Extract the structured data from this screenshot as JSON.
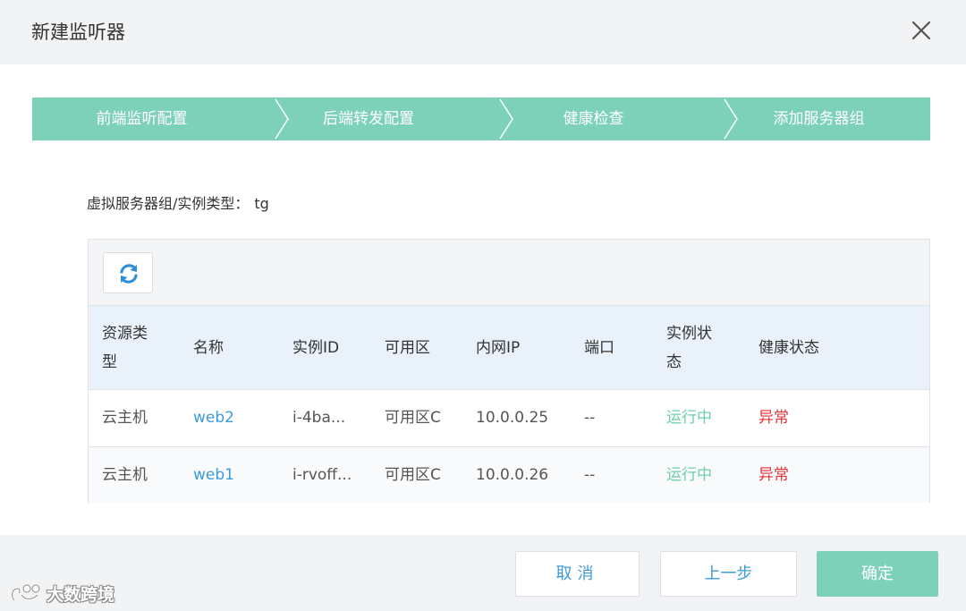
{
  "dialog": {
    "title": "新建监听器",
    "close_icon": "close-icon"
  },
  "steps": [
    {
      "label": "前端监听配置"
    },
    {
      "label": "后端转发配置"
    },
    {
      "label": "健康检查"
    },
    {
      "label": "添加服务器组"
    }
  ],
  "server_group": {
    "label": "虚拟服务器组/实例类型：",
    "value": "tg"
  },
  "toolbar": {
    "refresh_icon": "refresh-icon"
  },
  "table": {
    "headers": {
      "resource_type": "资源类型",
      "name": "名称",
      "instance_id": "实例ID",
      "zone": "可用区",
      "private_ip": "内网IP",
      "port": "端口",
      "instance_status": "实例状态",
      "health_status": "健康状态"
    },
    "rows": [
      {
        "resource_type": "云主机",
        "name": "web2",
        "instance_id": "i-4ba...",
        "zone": "可用区C",
        "private_ip": "10.0.0.25",
        "port": "--",
        "instance_status": "运行中",
        "health_status": "异常"
      },
      {
        "resource_type": "云主机",
        "name": "web1",
        "instance_id": "i-rvoff...",
        "zone": "可用区C",
        "private_ip": "10.0.0.26",
        "port": "--",
        "instance_status": "运行中",
        "health_status": "异常"
      }
    ]
  },
  "footer": {
    "cancel_label": "取消",
    "prev_label": "上一步",
    "ok_label": "确定"
  },
  "watermark": {
    "text": "大数跨境"
  },
  "colors": {
    "accent": "#7dd1b9",
    "link": "#3d9ad6",
    "running": "#6fcfa8",
    "error": "#e0343a"
  }
}
